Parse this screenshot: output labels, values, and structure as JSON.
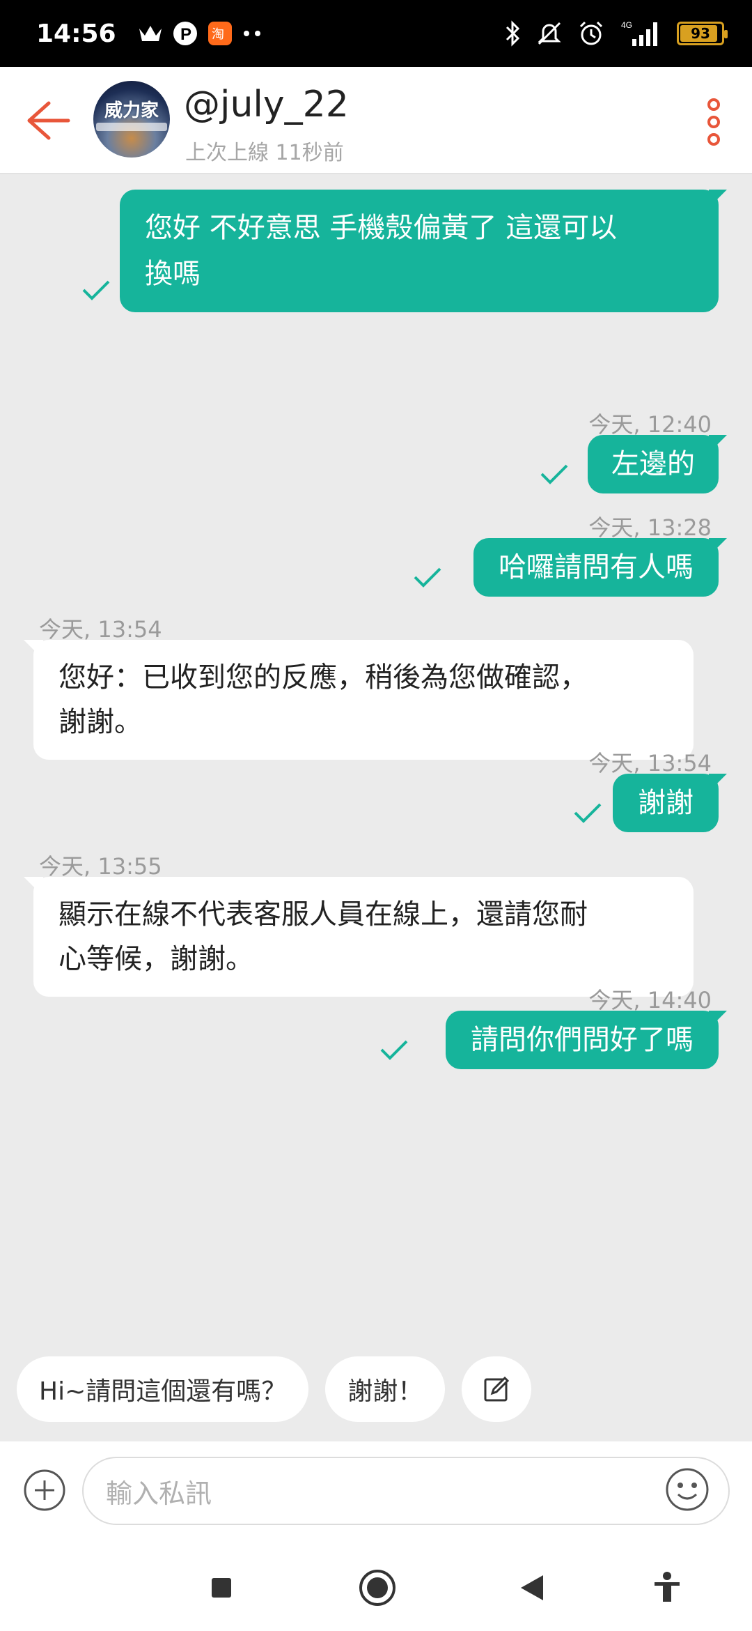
{
  "status_bar": {
    "time": "14:56",
    "battery": "93",
    "network": "4G"
  },
  "header": {
    "avatar_text": "威力家",
    "username": "@july_22",
    "last_online": "上次上線 11秒前"
  },
  "messages": [
    {
      "side": "me",
      "timestamp": "",
      "text_line1": "您好 不好意思 手機殼偏黃了 這還可以",
      "text_line2": "換嗎"
    },
    {
      "side": "me",
      "timestamp": "今天, 12:40",
      "text": "左邊的"
    },
    {
      "side": "me",
      "timestamp": "今天, 13:28",
      "text": "哈囉請問有人嗎"
    },
    {
      "side": "them",
      "timestamp": "今天, 13:54",
      "text_line1": "您好：已收到您的反應，稍後為您做確認，",
      "text_line2": "謝謝。"
    },
    {
      "side": "me",
      "timestamp": "今天, 13:54",
      "text": "謝謝"
    },
    {
      "side": "them",
      "timestamp": "今天, 13:55",
      "text_line1": "顯示在線不代表客服人員在線上，還請您耐",
      "text_line2": "心等候，謝謝。"
    },
    {
      "side": "me",
      "timestamp": "今天, 14:40",
      "text": "請問你們問好了嗎"
    }
  ],
  "quick_replies": [
    "Hi~請問這個還有嗎？",
    "謝謝！"
  ],
  "input": {
    "placeholder": "輸入私訊"
  },
  "colors": {
    "accent": "#16b49b",
    "header_icon": "#e8563a"
  }
}
